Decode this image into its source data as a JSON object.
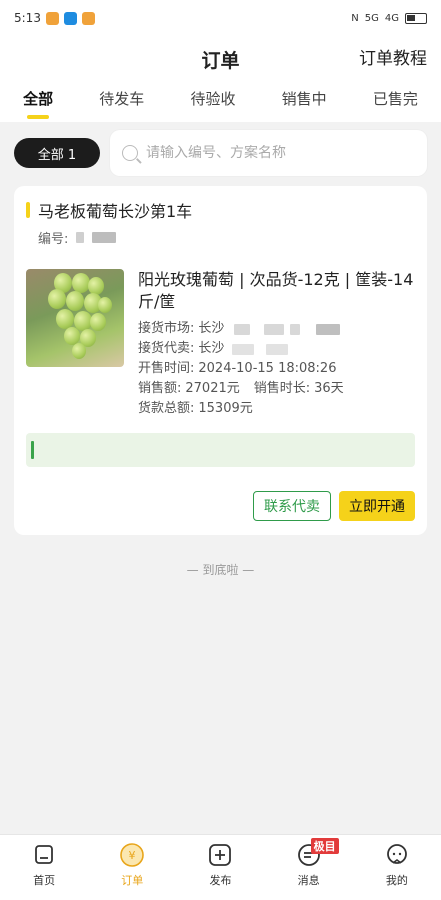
{
  "status": {
    "time": "5:13",
    "net": "5G",
    "net2": "4G"
  },
  "header": {
    "title": "订单",
    "right_link": "订单教程"
  },
  "tabs": [
    {
      "label": "全部"
    },
    {
      "label": "待发车"
    },
    {
      "label": "待验收"
    },
    {
      "label": "销售中"
    },
    {
      "label": "已售完"
    }
  ],
  "filter": {
    "all_label": "全部 1",
    "search_placeholder": "请输入编号、方案名称"
  },
  "order": {
    "title": "马老板葡萄长沙第1车",
    "code_label": "编号:",
    "product_name": "阳光玫瑰葡萄 | 次品货-12克 | 筐装-14斤/筐",
    "market_label": "接货市场:",
    "market_value": "长沙",
    "agent_label": "接货代卖:",
    "agent_value": "长沙",
    "open_time_label": "开售时间:",
    "open_time_value": "2024-10-15 18:08:26",
    "sales_label": "销售额:",
    "sales_value": "27021元",
    "duration_label": "销售时长:",
    "duration_value": "36天",
    "total_label": "货款总额:",
    "total_value": "15309元",
    "btn_contact": "联系代卖",
    "btn_open": "立即开通"
  },
  "bottom_note": "— 到底啦 —",
  "nav": [
    {
      "label": "首页"
    },
    {
      "label": "订单"
    },
    {
      "label": "发布"
    },
    {
      "label": "消息",
      "badge": "极目"
    },
    {
      "label": "我的"
    }
  ],
  "colors": {
    "accent": "#f5d21a",
    "green": "#2f9b4a",
    "active_nav": "#e8a51a"
  }
}
